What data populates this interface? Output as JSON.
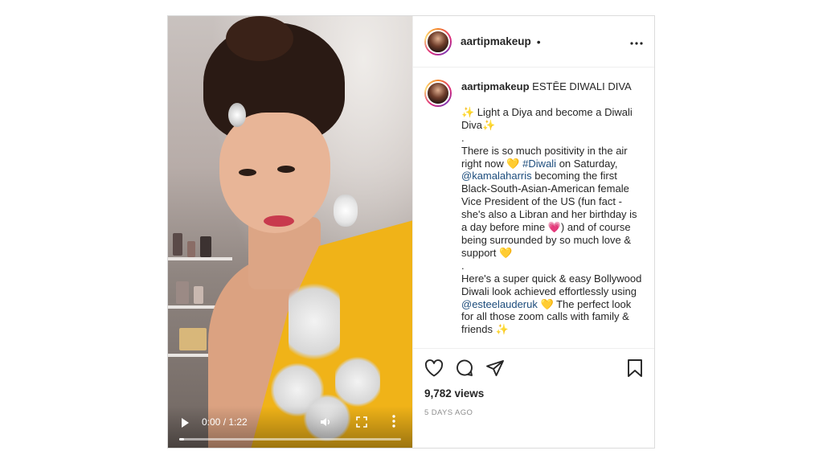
{
  "post": {
    "username": "aartipmakeup",
    "follow_dot": "•",
    "more_icon": "more-horizontal-icon"
  },
  "video": {
    "time": "0:00 / 1:22",
    "progress": 0.0,
    "icons": [
      "play-icon",
      "volume-icon",
      "fullscreen-icon",
      "more-vertical-icon"
    ]
  },
  "caption": {
    "username": "aartipmakeup",
    "title": "ESTĒE DIWALI DIVA",
    "line1_emoji": "✨",
    "line1_text": " Light a Diya and become a Diwali Diva",
    "line1_emoji_end": "✨",
    "sep1": ".",
    "p2_a": "There is so much positivity in the air right now ",
    "p2_heart1": "💛",
    "p2_tag": " #Diwali",
    "p2_b": " on Saturday, ",
    "p2_mention": "@kamalaharris",
    "p2_c": " becoming the first Black-South-Asian-American female Vice President of the US (fun fact - she's also a Libran and her birthday is a day before mine ",
    "p2_heart2": "💗",
    "p2_d": ") and of course being surrounded by so much love & support ",
    "p2_heart3": "💛",
    "sep2": ".",
    "p3_a": "Here's a super quick & easy Bollywood Diwali look achieved effortlessly using ",
    "p3_mention": "@esteelauderuk",
    "p3_heart": " 💛",
    "p3_b": " The perfect look for all those zoom calls with family & friends ",
    "p3_spark": "✨"
  },
  "actions": {
    "icons": [
      "heart-icon",
      "comment-icon",
      "share-icon",
      "bookmark-icon"
    ],
    "views": "9,782 views",
    "posted": "5 DAYS AGO"
  },
  "colors": {
    "link": "#1c4c7c",
    "muted": "#8e8e8e",
    "text": "#262626",
    "border": "#dbdbdb",
    "dress": "#f0b318"
  }
}
